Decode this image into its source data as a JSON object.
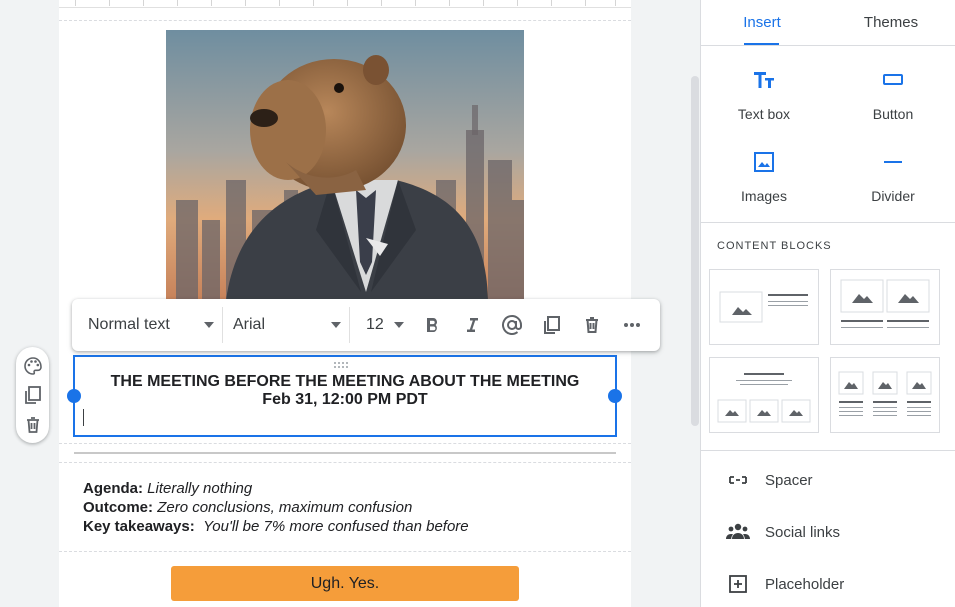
{
  "toolbar": {
    "text_style": "Normal text",
    "font": "Arial",
    "font_size": "12"
  },
  "text_block": {
    "title": "THE MEETING BEFORE THE MEETING ABOUT THE MEETING",
    "date": "Feb 31, 12:00 PM PDT"
  },
  "details": {
    "agenda_label": "Agenda:",
    "agenda_value": "Literally nothing",
    "outcome_label": "Outcome:",
    "outcome_value": "Zero conclusions, maximum confusion",
    "takeaways_label": "Key takeaways:",
    "takeaways_value": "You'll be 7% more confused than before"
  },
  "cta_button": {
    "label": "Ugh. Yes.",
    "color": "#f59d3a"
  },
  "panel": {
    "tabs": [
      {
        "label": "Insert",
        "active": true
      },
      {
        "label": "Themes",
        "active": false
      }
    ],
    "insert_items": [
      {
        "label": "Text box",
        "icon": "text-box-icon"
      },
      {
        "label": "Button",
        "icon": "button-icon"
      },
      {
        "label": "Images",
        "icon": "image-icon"
      },
      {
        "label": "Divider",
        "icon": "divider-icon"
      }
    ],
    "content_blocks_heading": "CONTENT BLOCKS",
    "list_items": [
      {
        "label": "Spacer",
        "icon": "spacer-icon"
      },
      {
        "label": "Social links",
        "icon": "people-icon"
      },
      {
        "label": "Placeholder",
        "icon": "add-box-icon"
      }
    ]
  },
  "colors": {
    "accent": "#1a73e8"
  }
}
